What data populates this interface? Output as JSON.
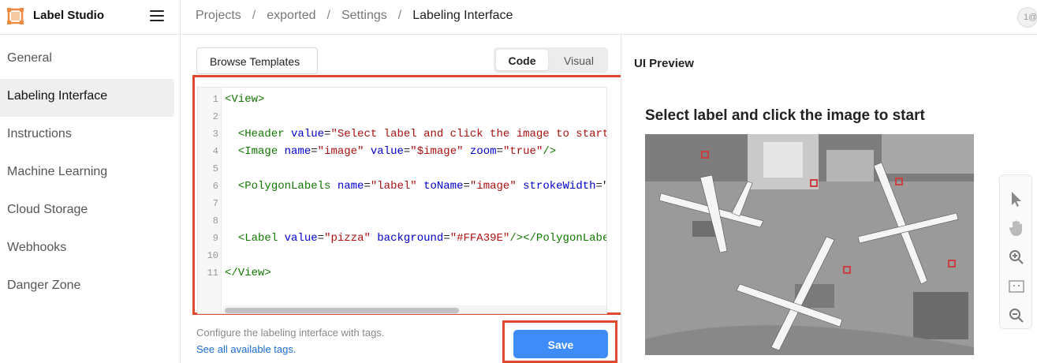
{
  "app": {
    "name": "Label Studio",
    "avatar_text": "1@"
  },
  "breadcrumb": [
    "Projects",
    "exported",
    "Settings",
    "Labeling Interface"
  ],
  "sidebar": {
    "items": [
      {
        "label": "General",
        "active": false
      },
      {
        "label": "Labeling Interface",
        "active": true
      },
      {
        "label": "Instructions",
        "active": false
      },
      {
        "label": "Machine Learning",
        "active": false
      },
      {
        "label": "Cloud Storage",
        "active": false
      },
      {
        "label": "Webhooks",
        "active": false
      },
      {
        "label": "Danger Zone",
        "active": false
      }
    ]
  },
  "main": {
    "browse_label": "Browse Templates",
    "tabs": {
      "code": "Code",
      "visual": "Visual",
      "selected": "Code"
    },
    "hint": "Configure the labeling interface with tags.",
    "hint_link": "See all available tags.",
    "save_label": "Save"
  },
  "editor": {
    "line_numbers": [
      "1",
      "2",
      "3",
      "4",
      "5",
      "6",
      "7",
      "8",
      "9",
      "10",
      "11"
    ],
    "lines": [
      [
        {
          "t": "tag",
          "v": "<View>"
        }
      ],
      [],
      [
        {
          "t": "plain",
          "v": "  "
        },
        {
          "t": "tag",
          "v": "<Header"
        },
        {
          "t": "plain",
          "v": " "
        },
        {
          "t": "attr",
          "v": "value"
        },
        {
          "t": "plain",
          "v": "="
        },
        {
          "t": "str",
          "v": "\"Select label and click the image to start"
        }
      ],
      [
        {
          "t": "plain",
          "v": "  "
        },
        {
          "t": "tag",
          "v": "<Image"
        },
        {
          "t": "plain",
          "v": " "
        },
        {
          "t": "attr",
          "v": "name"
        },
        {
          "t": "plain",
          "v": "="
        },
        {
          "t": "str",
          "v": "\"image\""
        },
        {
          "t": "plain",
          "v": " "
        },
        {
          "t": "attr",
          "v": "value"
        },
        {
          "t": "plain",
          "v": "="
        },
        {
          "t": "str",
          "v": "\"$image\""
        },
        {
          "t": "plain",
          "v": " "
        },
        {
          "t": "attr",
          "v": "zoom"
        },
        {
          "t": "plain",
          "v": "="
        },
        {
          "t": "str",
          "v": "\"true\""
        },
        {
          "t": "tag",
          "v": "/>"
        }
      ],
      [],
      [
        {
          "t": "plain",
          "v": "  "
        },
        {
          "t": "tag",
          "v": "<PolygonLabels"
        },
        {
          "t": "plain",
          "v": " "
        },
        {
          "t": "attr",
          "v": "name"
        },
        {
          "t": "plain",
          "v": "="
        },
        {
          "t": "str",
          "v": "\"label\""
        },
        {
          "t": "plain",
          "v": " "
        },
        {
          "t": "attr",
          "v": "toName"
        },
        {
          "t": "plain",
          "v": "="
        },
        {
          "t": "str",
          "v": "\"image\""
        },
        {
          "t": "plain",
          "v": " "
        },
        {
          "t": "attr",
          "v": "strokeWidth"
        },
        {
          "t": "plain",
          "v": "=\""
        }
      ],
      [],
      [],
      [
        {
          "t": "plain",
          "v": "  "
        },
        {
          "t": "tag",
          "v": "<Label"
        },
        {
          "t": "plain",
          "v": " "
        },
        {
          "t": "attr",
          "v": "value"
        },
        {
          "t": "plain",
          "v": "="
        },
        {
          "t": "str",
          "v": "\"pizza\""
        },
        {
          "t": "plain",
          "v": " "
        },
        {
          "t": "attr",
          "v": "background"
        },
        {
          "t": "plain",
          "v": "="
        },
        {
          "t": "str",
          "v": "\"#FFA39E\""
        },
        {
          "t": "tag",
          "v": "/></PolygonLabe"
        }
      ],
      [],
      [
        {
          "t": "tag",
          "v": "</View>"
        }
      ]
    ]
  },
  "preview": {
    "title": "UI Preview",
    "header": "Select label and click the image to start",
    "tools": [
      "pointer-icon",
      "hand-icon",
      "zoom-in-icon",
      "fit-icon",
      "zoom-out-icon"
    ]
  },
  "colors": {
    "accent": "#3d8cf8",
    "highlight": "#e0492e",
    "logo": "#f08a3e"
  }
}
